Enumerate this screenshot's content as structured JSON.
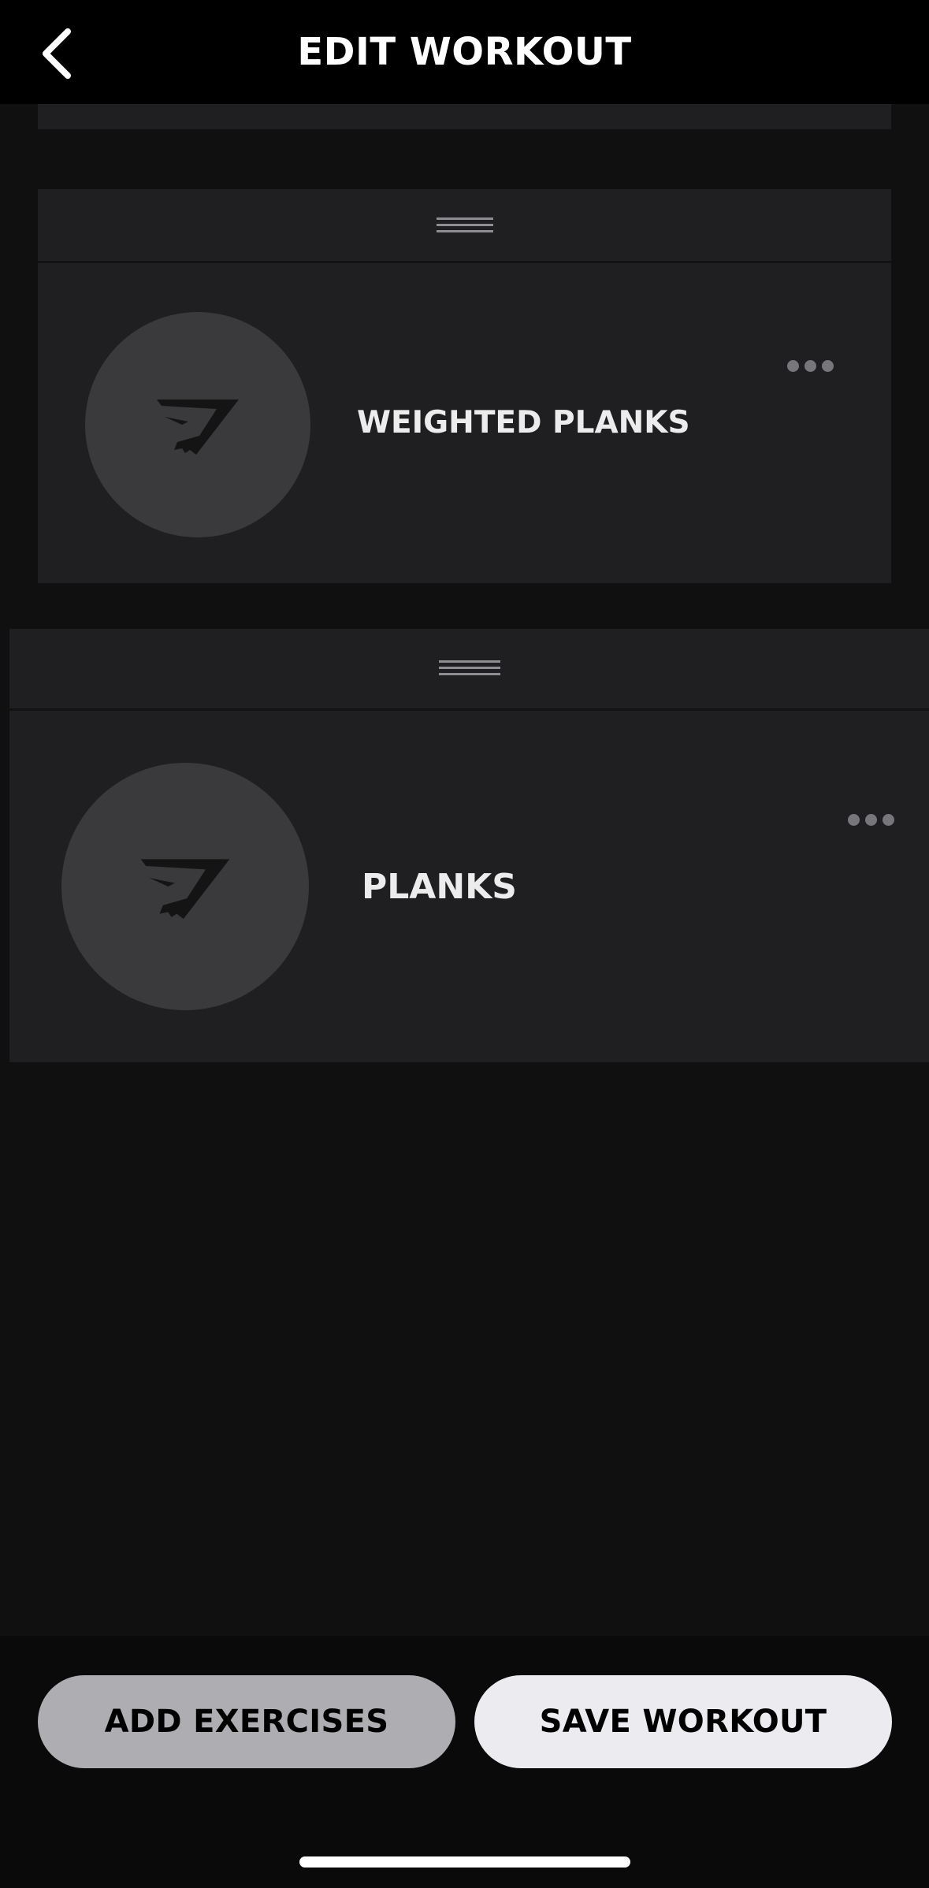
{
  "header": {
    "title": "EDIT WORKOUT",
    "back_icon": "chevron-left-icon"
  },
  "exercises": [
    {
      "name": "WEIGHTED PLANKS",
      "thumbnail_icon": "gymshark-logo-icon",
      "more_icon": "more-horizontal-icon",
      "drag_icon": "drag-handle-icon"
    },
    {
      "name": "PLANKS",
      "thumbnail_icon": "gymshark-logo-icon",
      "more_icon": "more-horizontal-icon",
      "drag_icon": "drag-handle-icon"
    }
  ],
  "actions": {
    "add_label": "ADD EXERCISES",
    "save_label": "SAVE WORKOUT"
  },
  "colors": {
    "background": "#101010",
    "card": "#1f1f21",
    "thumbnail": "#3a3a3c",
    "add_button": "#aeaeb2",
    "save_button": "#ebebf0"
  }
}
